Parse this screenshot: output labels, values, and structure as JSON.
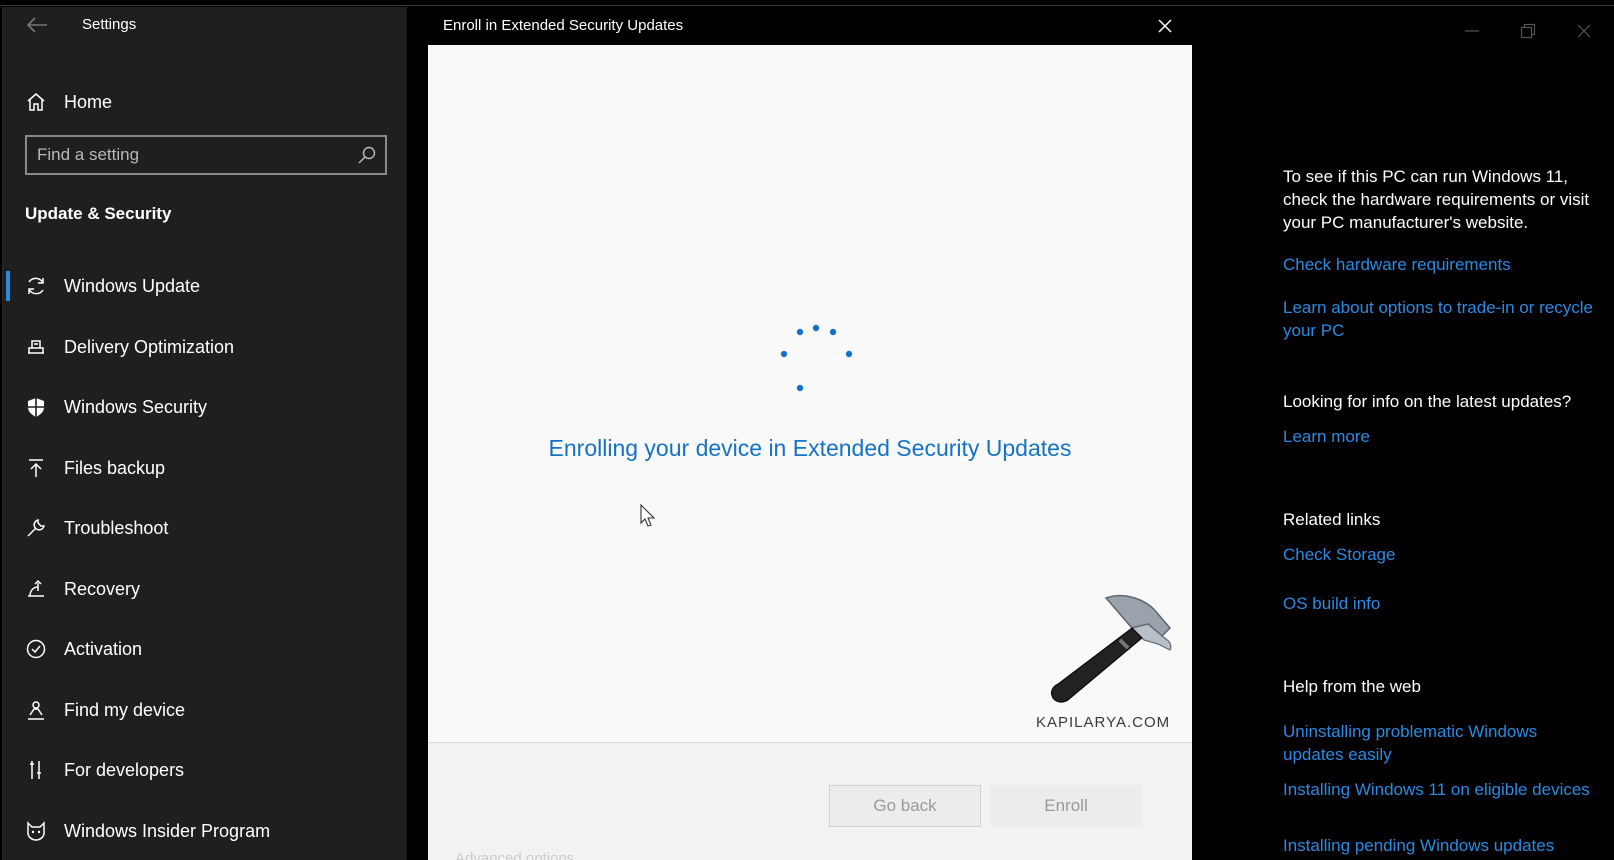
{
  "settings": {
    "app_title": "Settings",
    "home_label": "Home",
    "search_placeholder": "Find a setting",
    "section_title": "Update & Security",
    "nav_items": [
      {
        "label": "Windows Update",
        "icon": "sync-icon",
        "active": true
      },
      {
        "label": "Delivery Optimization",
        "icon": "delivery-icon"
      },
      {
        "label": "Windows Security",
        "icon": "shield-icon"
      },
      {
        "label": "Files backup",
        "icon": "upload-icon"
      },
      {
        "label": "Troubleshoot",
        "icon": "wrench-icon"
      },
      {
        "label": "Recovery",
        "icon": "recovery-icon"
      },
      {
        "label": "Activation",
        "icon": "check-circle-icon"
      },
      {
        "label": "Find my device",
        "icon": "person-pin-icon"
      },
      {
        "label": "For developers",
        "icon": "developer-tools-icon"
      },
      {
        "label": "Windows Insider Program",
        "icon": "cat-icon"
      }
    ]
  },
  "dialog": {
    "title": "Enroll in Extended Security Updates",
    "status_text": "Enrolling your device in Extended Security Updates",
    "watermark": "KAPILARYA.COM",
    "go_back_label": "Go back",
    "enroll_label": "Enroll",
    "partial_under_text": "Advanced options"
  },
  "right_panel": {
    "win11_text": "To see if this PC can run Windows 11, check the hardware requirements or visit your PC manufacturer's website.",
    "link_hardware": "Check hardware requirements",
    "link_tradein": "Learn about options to trade-in or recycle your PC",
    "latest_updates_heading": "Looking for info on the latest updates?",
    "link_learn_more": "Learn more",
    "related_links_heading": "Related links",
    "link_check_storage": "Check Storage",
    "link_os_build": "OS build info",
    "help_heading": "Help from the web",
    "link_uninstalling": "Uninstalling problematic Windows updates easily",
    "link_installing_w11": "Installing Windows 11 on eligible devices",
    "link_installing_pending": "Installing pending Windows updates"
  },
  "colors": {
    "accent": "#2b8ae2",
    "status_text": "#1673c4",
    "sidebar_bg": "#1f1f1f",
    "dialog_bg": "#f9f9f9"
  }
}
